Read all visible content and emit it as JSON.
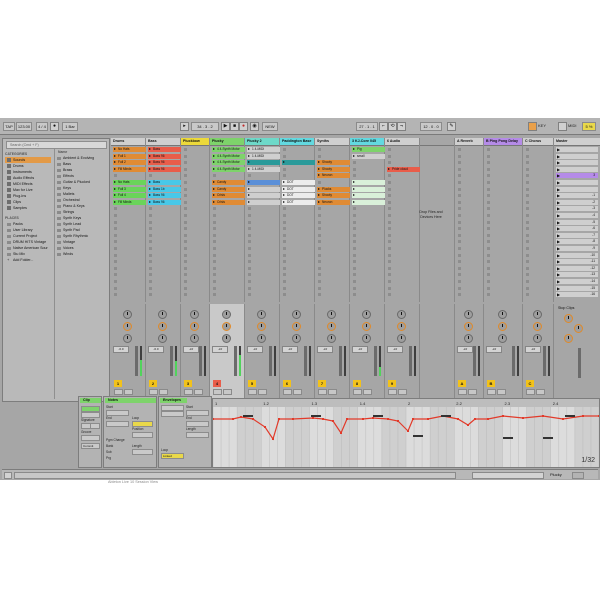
{
  "transport": {
    "tap": "TAP",
    "tempo": "123.00",
    "time_sig": "4 / 4",
    "metronome_mode": "1 Bar",
    "arrangement_pos": "34 . 3 . 2",
    "punch_start": "27 . 1 . 1",
    "punch_length": "12 . 0 . 0",
    "new": "NEW",
    "key": "KEY",
    "midi": "MIDI",
    "cpu": "5 %"
  },
  "browser": {
    "search_placeholder": "Search (Cmd + F)",
    "collections_label": "CATEGORIES",
    "categories": [
      "Sounds",
      "Drums",
      "Instruments",
      "Audio Effects",
      "MIDI Effects",
      "Max for Live",
      "Plug-Ins",
      "Clips",
      "Samples"
    ],
    "places_label": "PLACES",
    "places": [
      "Packs",
      "User Library",
      "Current Project",
      "DRUM HITS Vintage",
      "Native American Sour",
      "Stu Mix",
      "Add Folder..."
    ],
    "name_label": "Name",
    "items": [
      "Ambient & Evolving",
      "Bass",
      "Brass",
      "Effects",
      "Guitar & Plucked",
      "Keys",
      "Mallets",
      "Orchestral",
      "Piano & Keys",
      "Strings",
      "Synth Keys",
      "Synth Lead",
      "Synth Pad",
      "Synth Rhythmic",
      "Vintage",
      "Voices",
      "Winds"
    ]
  },
  "tracks": [
    {
      "name": "Drums",
      "color": "#cfcfcf",
      "clips": [
        {
          "label": "No Hats",
          "color": "#e08b34"
        },
        {
          "label": "Full 1",
          "color": "#e08b34"
        },
        {
          "label": "Full 2",
          "color": "#e08b34"
        },
        {
          "label": "Fill Minds",
          "color": "#e08b34"
        },
        {
          "label": "",
          "color": ""
        },
        {
          "label": "No Hats",
          "color": "#6ad45a"
        },
        {
          "label": "Full 3",
          "color": "#6ad45a"
        },
        {
          "label": "Full 4",
          "color": "#6ad45a"
        },
        {
          "label": "Fill Minds",
          "color": "#6ad45a"
        }
      ],
      "number": "1",
      "vol": "-6.0"
    },
    {
      "name": "Bass",
      "color": "#cfcfcf",
      "clips": [
        {
          "label": "Bass",
          "color": "#e95d4a"
        },
        {
          "label": "Bass 96",
          "color": "#e95d4a"
        },
        {
          "label": "Bass 96",
          "color": "#e95d4a"
        },
        {
          "label": "Bass 96",
          "color": "#e95d4a"
        },
        {
          "label": "",
          "color": ""
        },
        {
          "label": "Bass",
          "color": "#48c8e8"
        },
        {
          "label": "Bass 1b",
          "color": "#48c8e8"
        },
        {
          "label": "Bass 96",
          "color": "#48c8e8"
        },
        {
          "label": "Bass 96",
          "color": "#48c8e8"
        }
      ],
      "number": "2",
      "vol": "-6.0"
    },
    {
      "name": "Pluckbow",
      "color": "#ecd93a",
      "clips": [],
      "number": "3",
      "vol": "-inf"
    },
    {
      "name": "Plucky",
      "color": "#7ed36b",
      "clips": [
        {
          "label": "4 4-Synth Motor",
          "color": "#7ed36b"
        },
        {
          "label": "4 4-Synth Motor",
          "color": "#7ed36b"
        },
        {
          "label": "4 4-Synth Motor",
          "color": "#7ed36b"
        },
        {
          "label": "4 4-Synth Motor",
          "color": "#7ed36b"
        },
        {
          "label": "",
          "color": ""
        },
        {
          "label": "Candy",
          "color": "#e08b34"
        },
        {
          "label": "Candy",
          "color": "#e08b34"
        },
        {
          "label": "Crisis",
          "color": "#e08b34"
        },
        {
          "label": "Crisis",
          "color": "#e08b34"
        }
      ],
      "number": "4",
      "vol": "-inf"
    },
    {
      "name": "Plucky 2",
      "color": "#6ed9c9",
      "clips": [
        {
          "label": "1 4-MIDI",
          "color": "#cfcfcf"
        },
        {
          "label": "1 4-MIDI",
          "color": "#cfcfcf"
        },
        {
          "label": "",
          "color": "#2a9a9a"
        },
        {
          "label": "1 4-MIDI",
          "color": "#cfcfcf"
        },
        {
          "label": "",
          "color": ""
        },
        {
          "label": "",
          "color": "#5a8fd8"
        },
        {
          "label": "",
          "color": "#cfcfcf"
        },
        {
          "label": "",
          "color": "#cfcfcf"
        },
        {
          "label": "",
          "color": "#cfcfcf"
        }
      ],
      "number": "5",
      "vol": "-inf"
    },
    {
      "name": "Paddington Base",
      "color": "#63d9e0",
      "clips": [
        {
          "label": "",
          "color": ""
        },
        {
          "label": "",
          "color": ""
        },
        {
          "label": "",
          "color": "#2a9a9a"
        },
        {
          "label": "",
          "color": ""
        },
        {
          "label": "",
          "color": ""
        },
        {
          "label": "DOT",
          "color": "#ececec"
        },
        {
          "label": "DOT",
          "color": "#ececec"
        },
        {
          "label": "DOT",
          "color": "#ececec"
        },
        {
          "label": "DOT",
          "color": "#ececec"
        }
      ],
      "number": "6",
      "vol": "-inf"
    },
    {
      "name": "Synths",
      "color": "#cfcfcf",
      "clips": [
        {
          "label": "",
          "color": ""
        },
        {
          "label": "",
          "color": ""
        },
        {
          "label": "Shooty",
          "color": "#e08b34"
        },
        {
          "label": "Shooty",
          "color": "#e08b34"
        },
        {
          "label": "Neuron",
          "color": "#e08b34"
        },
        {
          "label": "",
          "color": ""
        },
        {
          "label": "Plucks",
          "color": "#e08b34"
        },
        {
          "label": "Shooty",
          "color": "#e08b34"
        },
        {
          "label": "Neuron",
          "color": "#e08b34"
        }
      ],
      "number": "7",
      "vol": "-inf"
    },
    {
      "name": "3 KJ-Core 045",
      "color": "#63d9e0",
      "clips": [
        {
          "label": "Pig",
          "color": "#7ed36b"
        },
        {
          "label": "small",
          "color": "#cfcfcf"
        },
        {
          "label": "",
          "color": ""
        },
        {
          "label": "",
          "color": ""
        },
        {
          "label": "",
          "color": ""
        },
        {
          "label": "",
          "color": "#d9f0d9"
        },
        {
          "label": "",
          "color": "#d9f0d9"
        },
        {
          "label": "",
          "color": "#d9f0d9"
        },
        {
          "label": "",
          "color": "#d9f0d9"
        }
      ],
      "number": "8",
      "vol": "-inf"
    },
    {
      "name": "6 Audio",
      "color": "#cfcfcf",
      "clips": [
        {
          "label": "",
          "color": ""
        },
        {
          "label": "",
          "color": ""
        },
        {
          "label": "",
          "color": ""
        },
        {
          "label": "Pride cloud",
          "color": "#e95d4a"
        }
      ],
      "number": "9",
      "vol": "-inf"
    },
    {
      "name": "",
      "color": "#a6a6a6",
      "clips": [],
      "number": "",
      "vol": ""
    },
    {
      "name": "A Reverb",
      "color": "#cfcfcf",
      "clips": [],
      "number": "A",
      "vol": "-inf"
    },
    {
      "name": "B Ping Pong Delay",
      "color": "#b58be8",
      "clips": [],
      "number": "B",
      "vol": "-inf"
    },
    {
      "name": "C Chorus",
      "color": "#cfcfcf",
      "clips": [],
      "number": "C",
      "vol": "-inf"
    }
  ],
  "drop_text": "Drop Files and Devices Here",
  "master": {
    "name": "Master",
    "scenes": [
      "",
      "",
      "",
      "",
      "3",
      "",
      "",
      "-1",
      "-2",
      "-3",
      "-4",
      "-5",
      "-6",
      "-7",
      "-8",
      "-9",
      "-10",
      "-11",
      "-12",
      "-13",
      "-14",
      "-15",
      "-16"
    ],
    "stop_clips": "Stop Clips"
  },
  "clip_panel": {
    "title": "Clip",
    "signature_label": "Signature",
    "groove_label": "Groove",
    "commit": "Commit"
  },
  "notes_panel": {
    "title": "Notes",
    "start_label": "Start",
    "end_label": "End",
    "length_label": "Length",
    "loop_label": "Loop",
    "position_label": "Position",
    "pgm_change_label": "Pgm Change",
    "bank_label": "Bank",
    "sub_label": "Sub",
    "prg_label": "Prg"
  },
  "envelopes_panel": {
    "title": "Envelopes",
    "linked": "Linked",
    "loop": "Loop",
    "start": "Start",
    "end": "End",
    "length": "Length"
  },
  "editor": {
    "grid": "1/32",
    "ruler": [
      "1",
      "1.2",
      "1.3",
      "1.4",
      "2",
      "2.2",
      "2.3",
      "2.4"
    ]
  },
  "statusbar": {
    "track_label": "Plucky",
    "colors": {
      "accent": "#f0a24a",
      "clip_text": "#e23a2a"
    }
  },
  "footer_caption": "Ableton Live 10 Session View"
}
